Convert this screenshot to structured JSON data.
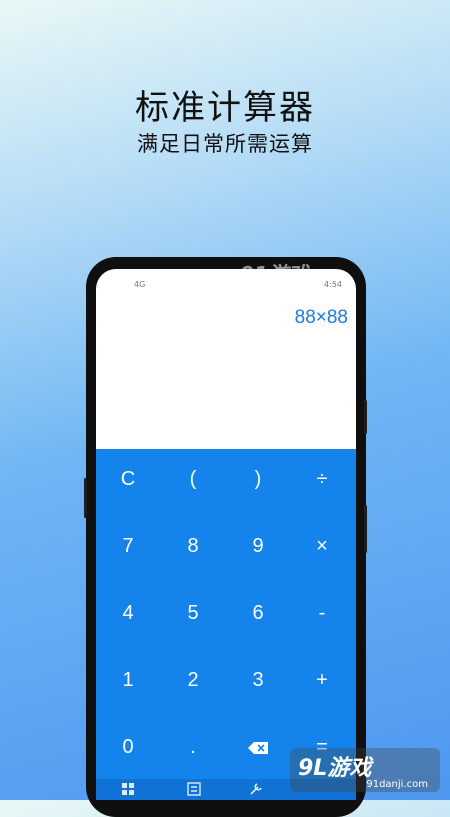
{
  "promo": {
    "title": "标准计算器",
    "subtitle": "满足日常所需运算"
  },
  "status_bar": {
    "signal": "4G",
    "time": "4:54"
  },
  "calculator": {
    "expression": "88×88",
    "accent_color": "#1484ec",
    "keys": [
      [
        "C",
        "(",
        ")",
        "÷"
      ],
      [
        "7",
        "8",
        "9",
        "×"
      ],
      [
        "4",
        "5",
        "6",
        "-"
      ],
      [
        "1",
        "2",
        "3",
        "+"
      ],
      [
        "0",
        ".",
        "backspace-icon",
        "="
      ]
    ]
  },
  "bottom_nav": {
    "icons": [
      "calculator-icon",
      "scientific-icon",
      "tools-icon"
    ]
  },
  "watermark": {
    "top": "91游戏",
    "brand": "9L游戏",
    "url": "91danji.com"
  }
}
